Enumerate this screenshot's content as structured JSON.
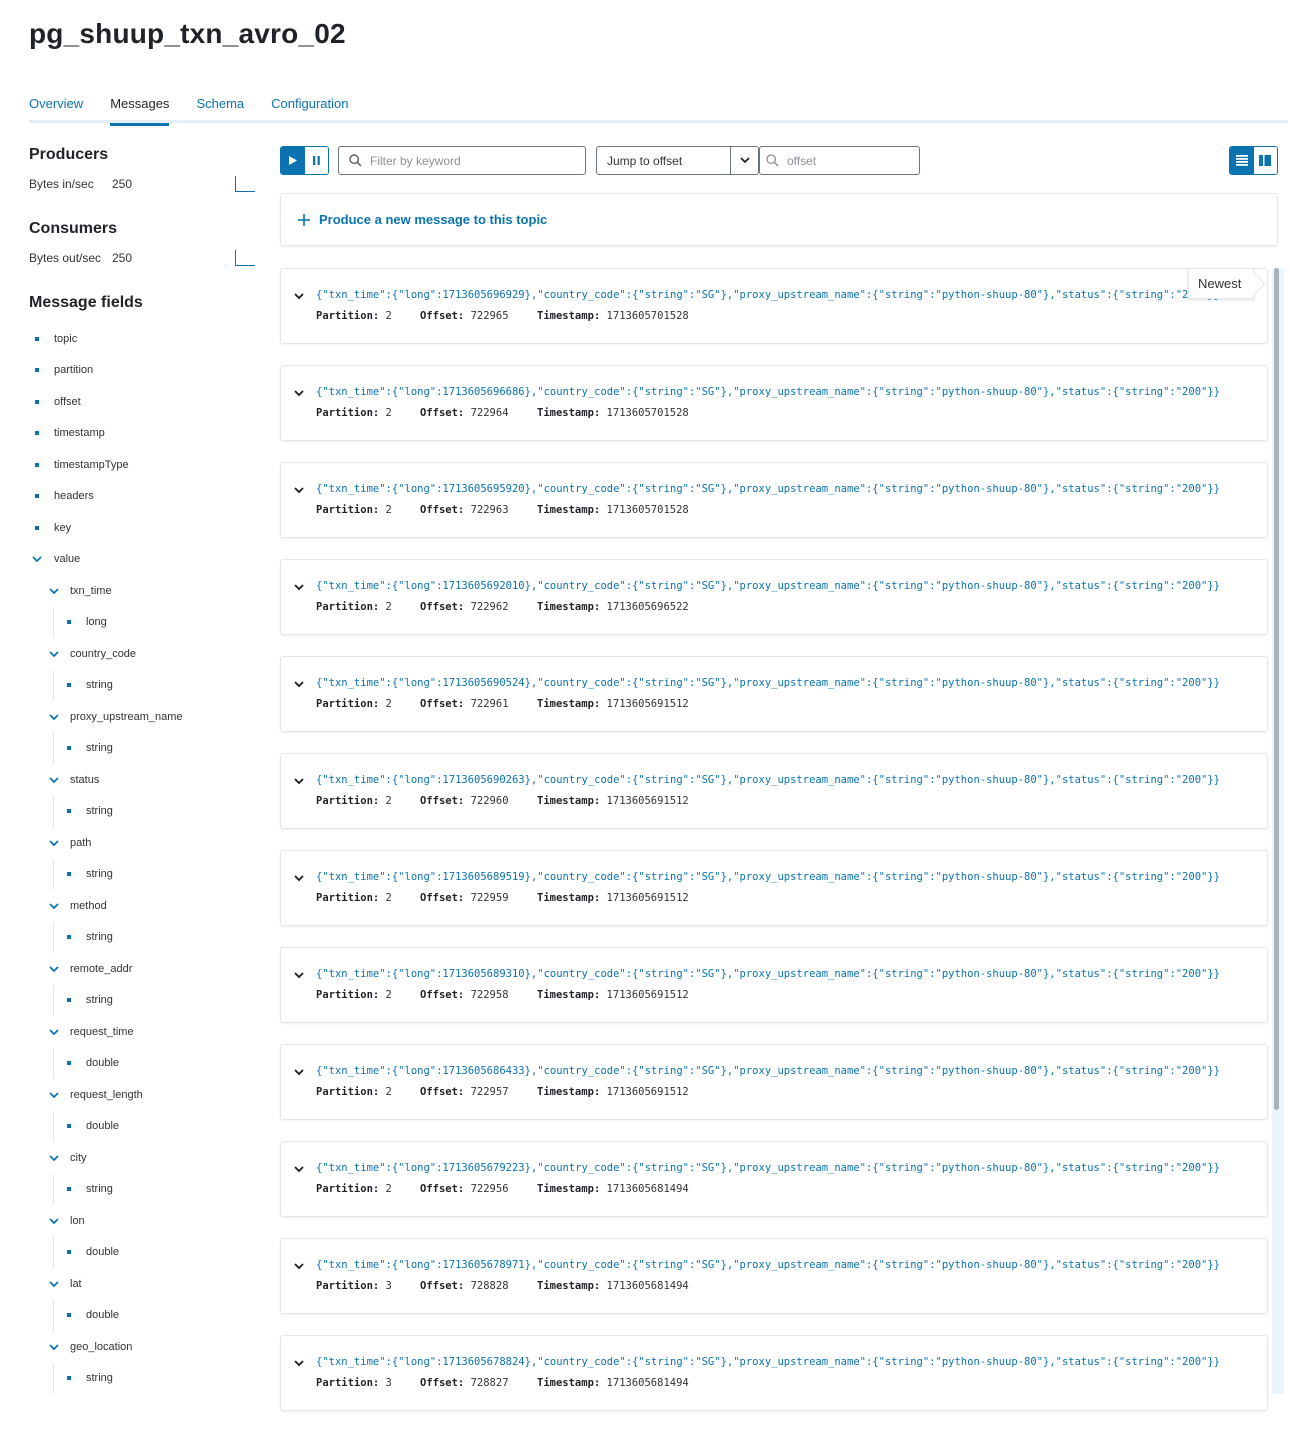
{
  "page": {
    "title": "pg_shuup_txn_avro_02"
  },
  "tabs": [
    {
      "label": "Overview"
    },
    {
      "label": "Messages"
    },
    {
      "label": "Schema"
    },
    {
      "label": "Configuration"
    }
  ],
  "active_tab": "Messages",
  "producers": {
    "heading": "Producers",
    "metric_label": "Bytes in/sec",
    "metric_value": "250"
  },
  "consumers": {
    "heading": "Consumers",
    "metric_label": "Bytes out/sec",
    "metric_value": "250"
  },
  "message_fields": {
    "heading": "Message fields",
    "items": [
      "topic",
      "partition",
      "offset",
      "timestamp",
      "timestampType",
      "headers",
      "key",
      "value",
      "txn_time",
      "long",
      "country_code",
      "string",
      "proxy_upstream_name",
      "string",
      "status",
      "string",
      "path",
      "string",
      "method",
      "string",
      "remote_addr",
      "string",
      "request_time",
      "double",
      "request_length",
      "double",
      "city",
      "string",
      "lon",
      "double",
      "lat",
      "double",
      "geo_location",
      "string"
    ]
  },
  "toolbar": {
    "filter_placeholder": "Filter by keyword",
    "jump_select_value": "Jump to offset",
    "offset_placeholder": "offset"
  },
  "produce": {
    "label": "Produce a new message to this topic"
  },
  "newest_label": "Newest",
  "meta_labels": {
    "partition": "Partition:",
    "offset": "Offset:",
    "timestamp": "Timestamp:"
  },
  "messages": [
    {
      "payload": "{\"txn_time\":{\"long\":1713605696929},\"country_code\":{\"string\":\"SG\"},\"proxy_upstream_name\":{\"string\":\"python-shuup-80\"},\"status\":{\"string\":\"200\"}}",
      "partition": "2",
      "offset": "722965",
      "timestamp": "1713605701528"
    },
    {
      "payload": "{\"txn_time\":{\"long\":1713605696686},\"country_code\":{\"string\":\"SG\"},\"proxy_upstream_name\":{\"string\":\"python-shuup-80\"},\"status\":{\"string\":\"200\"}}",
      "partition": "2",
      "offset": "722964",
      "timestamp": "1713605701528"
    },
    {
      "payload": "{\"txn_time\":{\"long\":1713605695920},\"country_code\":{\"string\":\"SG\"},\"proxy_upstream_name\":{\"string\":\"python-shuup-80\"},\"status\":{\"string\":\"200\"}}",
      "partition": "2",
      "offset": "722963",
      "timestamp": "1713605701528"
    },
    {
      "payload": "{\"txn_time\":{\"long\":1713605692010},\"country_code\":{\"string\":\"SG\"},\"proxy_upstream_name\":{\"string\":\"python-shuup-80\"},\"status\":{\"string\":\"200\"}}",
      "partition": "2",
      "offset": "722962",
      "timestamp": "1713605696522"
    },
    {
      "payload": "{\"txn_time\":{\"long\":1713605690524},\"country_code\":{\"string\":\"SG\"},\"proxy_upstream_name\":{\"string\":\"python-shuup-80\"},\"status\":{\"string\":\"200\"}}",
      "partition": "2",
      "offset": "722961",
      "timestamp": "1713605691512"
    },
    {
      "payload": "{\"txn_time\":{\"long\":1713605690263},\"country_code\":{\"string\":\"SG\"},\"proxy_upstream_name\":{\"string\":\"python-shuup-80\"},\"status\":{\"string\":\"200\"}}",
      "partition": "2",
      "offset": "722960",
      "timestamp": "1713605691512"
    },
    {
      "payload": "{\"txn_time\":{\"long\":1713605689519},\"country_code\":{\"string\":\"SG\"},\"proxy_upstream_name\":{\"string\":\"python-shuup-80\"},\"status\":{\"string\":\"200\"}}",
      "partition": "2",
      "offset": "722959",
      "timestamp": "1713605691512"
    },
    {
      "payload": "{\"txn_time\":{\"long\":1713605689310},\"country_code\":{\"string\":\"SG\"},\"proxy_upstream_name\":{\"string\":\"python-shuup-80\"},\"status\":{\"string\":\"200\"}}",
      "partition": "2",
      "offset": "722958",
      "timestamp": "1713605691512"
    },
    {
      "payload": "{\"txn_time\":{\"long\":1713605686433},\"country_code\":{\"string\":\"SG\"},\"proxy_upstream_name\":{\"string\":\"python-shuup-80\"},\"status\":{\"string\":\"200\"}}",
      "partition": "2",
      "offset": "722957",
      "timestamp": "1713605691512"
    },
    {
      "payload": "{\"txn_time\":{\"long\":1713605679223},\"country_code\":{\"string\":\"SG\"},\"proxy_upstream_name\":{\"string\":\"python-shuup-80\"},\"status\":{\"string\":\"200\"}}",
      "partition": "2",
      "offset": "722956",
      "timestamp": "1713605681494"
    },
    {
      "payload": "{\"txn_time\":{\"long\":1713605678971},\"country_code\":{\"string\":\"SG\"},\"proxy_upstream_name\":{\"string\":\"python-shuup-80\"},\"status\":{\"string\":\"200\"}}",
      "partition": "3",
      "offset": "728828",
      "timestamp": "1713605681494"
    },
    {
      "payload": "{\"txn_time\":{\"long\":1713605678824},\"country_code\":{\"string\":\"SG\"},\"proxy_upstream_name\":{\"string\":\"python-shuup-80\"},\"status\":{\"string\":\"200\"}}",
      "partition": "3",
      "offset": "728827",
      "timestamp": "1713605681494"
    }
  ]
}
